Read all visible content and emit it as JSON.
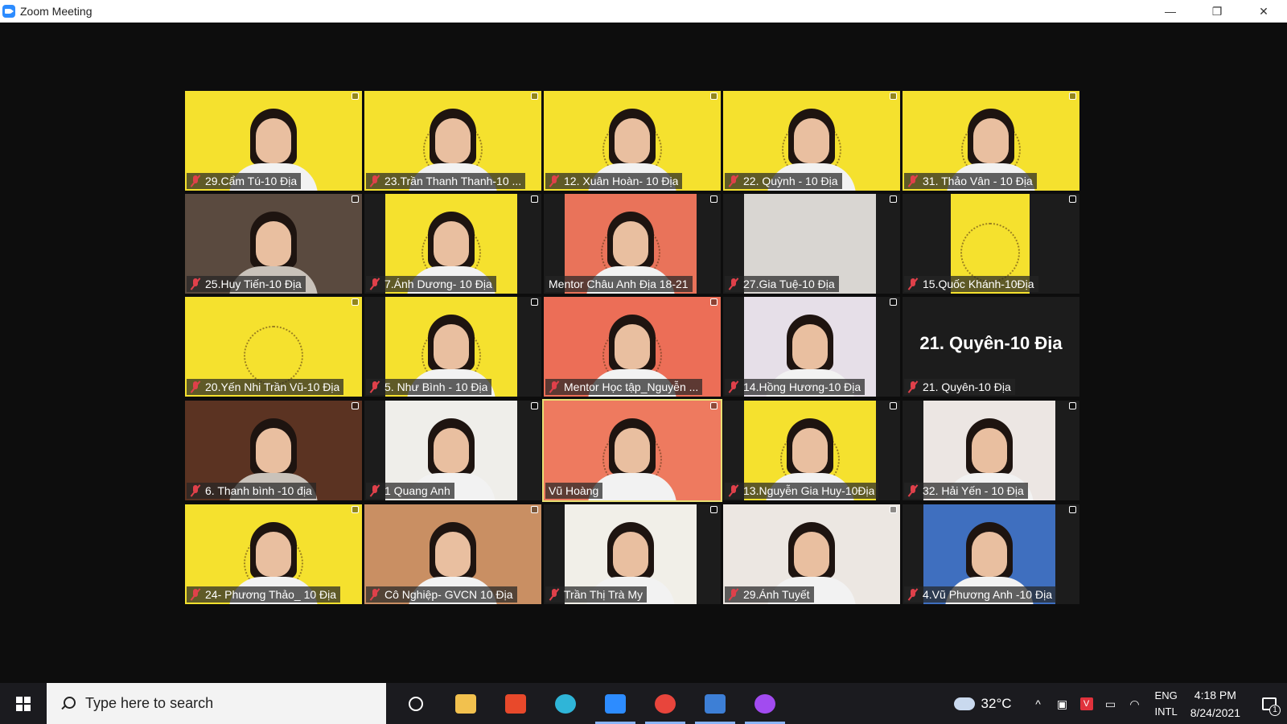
{
  "window": {
    "title": "Zoom Meeting",
    "minimize": "—",
    "restore": "❐",
    "close": "✕"
  },
  "participants": [
    {
      "name": "29.Cẩm Tú-10 Địa",
      "muted": true,
      "bg": "#f5e12e",
      "cam": "face"
    },
    {
      "name": "23.Trần Thanh Thanh-10 ...",
      "muted": true,
      "bg": "#f5e12e",
      "cam": "badge"
    },
    {
      "name": "12. Xuân Hoàn- 10 Địa",
      "muted": true,
      "bg": "#f5e12e",
      "cam": "badge"
    },
    {
      "name": "22. Quỳnh - 10 Địa",
      "muted": true,
      "bg": "#f5e12e",
      "cam": "badge"
    },
    {
      "name": "31. Thảo Vân - 10 Địa",
      "muted": true,
      "bg": "#f5e12e",
      "cam": "badge"
    },
    {
      "name": "25.Huy Tiến-10 Địa",
      "muted": true,
      "bg": "#5a4a3f",
      "cam": "room"
    },
    {
      "name": "7.Ánh Dương- 10 Địa",
      "muted": true,
      "bg": "#f5e12e",
      "cam": "narrow"
    },
    {
      "name": "Mentor Châu Anh Địa 18-21",
      "muted": false,
      "bg": "#e9735a",
      "cam": "narrow"
    },
    {
      "name": "27.Gia Tuệ-10 Địa",
      "muted": true,
      "bg": "#d9d6d2",
      "cam": "narrow-empty"
    },
    {
      "name": "15.Quốc Khánh-10Địa",
      "muted": true,
      "bg": "#f5e12e",
      "cam": "small"
    },
    {
      "name": "20.Yến Nhi Trần Vũ-10 Địa",
      "muted": true,
      "bg": "#f5e12e",
      "cam": "badge-empty"
    },
    {
      "name": "5. Như Bình - 10 Địa",
      "muted": true,
      "bg": "#f5e12e",
      "cam": "narrow"
    },
    {
      "name": "Mentor Học tập_Nguyễn ...",
      "muted": true,
      "bg": "#ec6e57",
      "cam": "badge"
    },
    {
      "name": "14.Hồng Hương-10 Địa",
      "muted": true,
      "bg": "#e6dfe8",
      "cam": "narrow"
    },
    {
      "name": "21. Quyên-10 Địa",
      "muted": true,
      "bg": "#1c1c1c",
      "cam": "none",
      "big_name": "21. Quyên-10 Địa"
    },
    {
      "name": "6. Thanh bình -10 địa",
      "muted": true,
      "bg": "#5b3322",
      "cam": "room"
    },
    {
      "name": "1 Quang Anh",
      "muted": true,
      "bg": "#efeeea",
      "cam": "narrow"
    },
    {
      "name": "Vũ Hoàng",
      "muted": false,
      "bg": "#ee7a5f",
      "cam": "badge",
      "active": true
    },
    {
      "name": "13.Nguyễn Gia Huy-10Địa",
      "muted": true,
      "bg": "#f5e12e",
      "cam": "narrow"
    },
    {
      "name": "32. Hải Yến - 10 Địa",
      "muted": true,
      "bg": "#ece6e3",
      "cam": "narrow"
    },
    {
      "name": "24- Phương Thảo_ 10 Địa",
      "muted": true,
      "bg": "#f5e12e",
      "cam": "badge"
    },
    {
      "name": "Cô Nghiệp- GVCN 10 Địa",
      "muted": true,
      "bg": "#c98f63",
      "cam": "face"
    },
    {
      "name": "Trần Thị Trà My",
      "muted": true,
      "bg": "#f1efe8",
      "cam": "narrow"
    },
    {
      "name": "29.Ánh Tuyết",
      "muted": true,
      "bg": "#ece7e2",
      "cam": "face"
    },
    {
      "name": "4.Vũ Phương Anh -10 Địa",
      "muted": true,
      "bg": "#3f6fbf",
      "cam": "narrow"
    }
  ],
  "taskbar": {
    "search_placeholder": "Type here to search",
    "apps": [
      {
        "name": "file-explorer",
        "color": "#f2c14e",
        "running": false
      },
      {
        "name": "office",
        "color": "#e8492b",
        "running": false
      },
      {
        "name": "edge",
        "color": "#2fb5d8",
        "running": false
      },
      {
        "name": "zoom",
        "color": "#2d8cff",
        "running": true
      },
      {
        "name": "chrome",
        "color": "#e8453c",
        "running": true
      },
      {
        "name": "store",
        "color": "#3d7fd6",
        "running": true
      },
      {
        "name": "messenger",
        "color": "#a24bf0",
        "running": true
      }
    ],
    "weather_temp": "32°C",
    "language_line1": "ENG",
    "language_line2": "INTL",
    "time": "4:18 PM",
    "date": "8/24/2021",
    "notification_count": "1"
  }
}
